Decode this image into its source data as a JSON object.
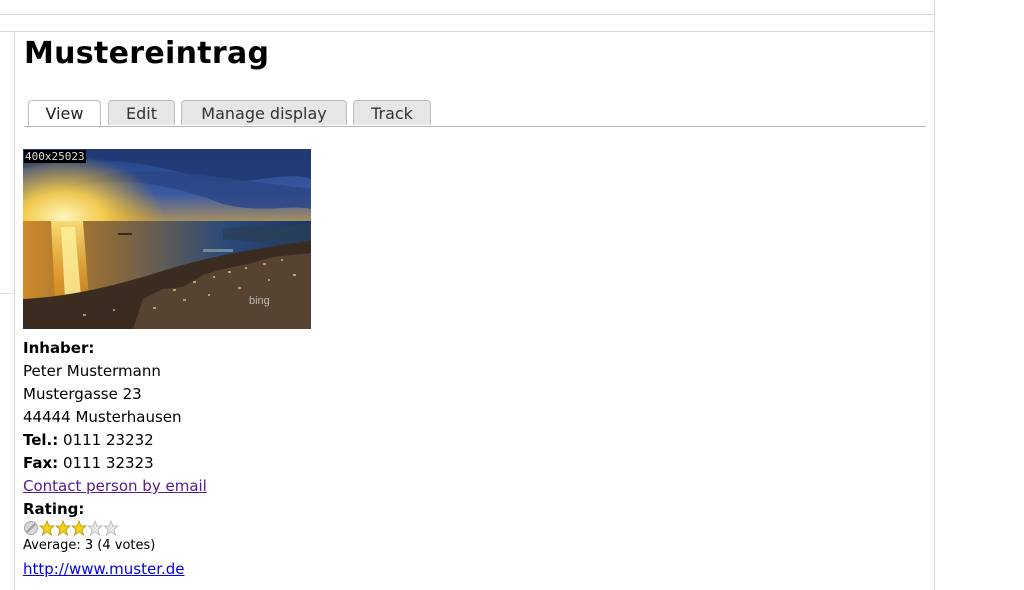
{
  "page": {
    "title": "Mustereintrag"
  },
  "tabs": [
    {
      "label": "View",
      "active": true
    },
    {
      "label": "Edit",
      "active": false
    },
    {
      "label": "Manage display",
      "active": false
    },
    {
      "label": "Track",
      "active": false
    }
  ],
  "image": {
    "label": "400x25023",
    "watermark": "bing"
  },
  "owner": {
    "heading": "Inhaber:",
    "name": "Peter Mustermann",
    "street": "Mustergasse 23",
    "city": "44444 Musterhausen",
    "tel_label": "Tel.:",
    "tel_value": "0111 23232",
    "fax_label": "Fax:",
    "fax_value": "0111 32323",
    "email_link": "Contact person by email"
  },
  "rating": {
    "heading": "Rating:",
    "value": 3,
    "max": 5,
    "average_text": "Average: 3 (4 votes)",
    "star_color": "#f2d21b",
    "empty_color": "#e6e6e6",
    "cancel_icon": "cancel-rating-icon"
  },
  "website": {
    "url": "http://www.muster.de"
  }
}
